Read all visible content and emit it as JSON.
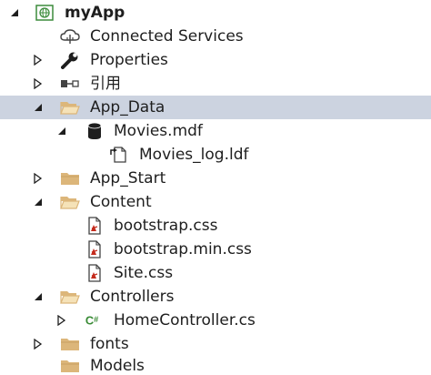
{
  "tree": {
    "project": {
      "label": "myApp",
      "icon": "web-project-icon"
    },
    "items": [
      {
        "label": "Connected Services",
        "icon": "connected-services-icon"
      },
      {
        "label": "Properties",
        "icon": "wrench-icon"
      },
      {
        "label": "引用",
        "icon": "references-icon"
      },
      {
        "label": "App_Data",
        "icon": "folder-open-icon",
        "selected": true
      },
      {
        "label": "Movies.mdf",
        "icon": "database-icon"
      },
      {
        "label": "Movies_log.ldf",
        "icon": "log-file-icon"
      },
      {
        "label": "App_Start",
        "icon": "folder-icon"
      },
      {
        "label": "Content",
        "icon": "folder-open-icon"
      },
      {
        "label": "bootstrap.css",
        "icon": "css-file-icon"
      },
      {
        "label": "bootstrap.min.css",
        "icon": "css-file-icon"
      },
      {
        "label": "Site.css",
        "icon": "css-file-icon"
      },
      {
        "label": "Controllers",
        "icon": "folder-open-icon"
      },
      {
        "label": "HomeController.cs",
        "icon": "csharp-file-icon"
      },
      {
        "label": "fonts",
        "icon": "folder-icon"
      },
      {
        "label": "Models",
        "icon": "folder-icon"
      }
    ]
  },
  "colors": {
    "selection": "#ccd3e0",
    "folder": "#dcb67a",
    "text": "#1e1e1e",
    "csharp": "#388a34"
  }
}
